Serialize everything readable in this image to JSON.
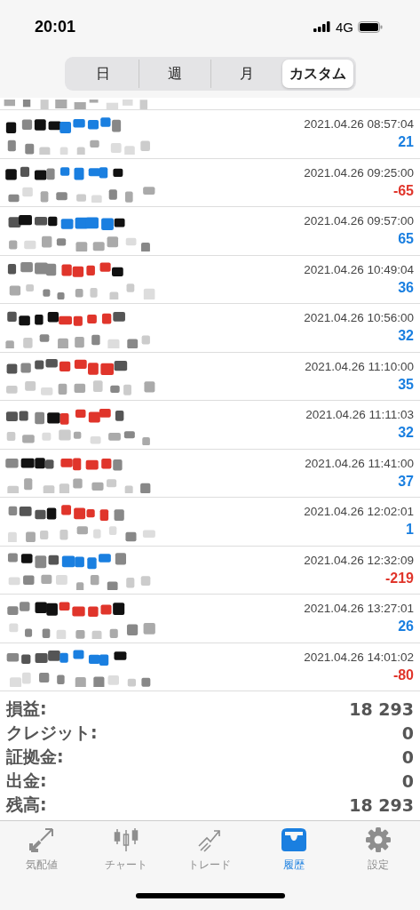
{
  "status_bar": {
    "time": "20:01",
    "network": "4G"
  },
  "tabs": [
    {
      "label": "日",
      "selected": false
    },
    {
      "label": "週",
      "selected": false
    },
    {
      "label": "月",
      "selected": false
    },
    {
      "label": "カスタム",
      "selected": true
    }
  ],
  "deals": [
    {
      "time": "2021.04.26 08:57:04",
      "profit": {
        "value": "21",
        "color": "#1a7fe0"
      },
      "color": "#1a7fe0"
    },
    {
      "time": "2021.04.26 09:25:00",
      "profit": {
        "value": "-65",
        "color": "#e0352b"
      },
      "color": "#1a7fe0"
    },
    {
      "time": "2021.04.26 09:57:00",
      "profit": {
        "value": "65",
        "color": "#1a7fe0"
      },
      "color": "#1a7fe0"
    },
    {
      "time": "2021.04.26 10:49:04",
      "profit": {
        "value": "36",
        "color": "#1a7fe0"
      },
      "color": "#e0352b"
    },
    {
      "time": "2021.04.26 10:56:00",
      "profit": {
        "value": "32",
        "color": "#1a7fe0"
      },
      "color": "#e0352b"
    },
    {
      "time": "2021.04.26 11:10:00",
      "profit": {
        "value": "35",
        "color": "#1a7fe0"
      },
      "color": "#e0352b"
    },
    {
      "time": "2021.04.26 11:11:03",
      "profit": {
        "value": "32",
        "color": "#1a7fe0"
      },
      "color": "#e0352b"
    },
    {
      "time": "2021.04.26 11:41:00",
      "profit": {
        "value": "37",
        "color": "#1a7fe0"
      },
      "color": "#e0352b"
    },
    {
      "time": "2021.04.26 12:02:01",
      "profit": {
        "value": "1",
        "color": "#1a7fe0"
      },
      "color": "#e0352b"
    },
    {
      "time": "2021.04.26 12:32:09",
      "profit": {
        "value": "-219",
        "color": "#e0352b"
      },
      "color": "#1a7fe0"
    },
    {
      "time": "2021.04.26 13:27:01",
      "profit": {
        "value": "26",
        "color": "#1a7fe0"
      },
      "color": "#e0352b"
    },
    {
      "time": "2021.04.26 14:01:02",
      "profit": {
        "value": "-80",
        "color": "#e0352b"
      },
      "color": "#1a7fe0"
    }
  ],
  "summary": [
    {
      "label": "損益:",
      "value": "18 293"
    },
    {
      "label": "クレジット:",
      "value": "0"
    },
    {
      "label": "証拠金:",
      "value": "0"
    },
    {
      "label": "出金:",
      "value": "0"
    },
    {
      "label": "残高:",
      "value": "18 293"
    }
  ],
  "tab_bar": [
    {
      "label": "気配値",
      "selected": false
    },
    {
      "label": "チャート",
      "selected": false
    },
    {
      "label": "トレード",
      "selected": false
    },
    {
      "label": "履歴",
      "selected": true
    },
    {
      "label": "設定",
      "selected": false
    }
  ]
}
